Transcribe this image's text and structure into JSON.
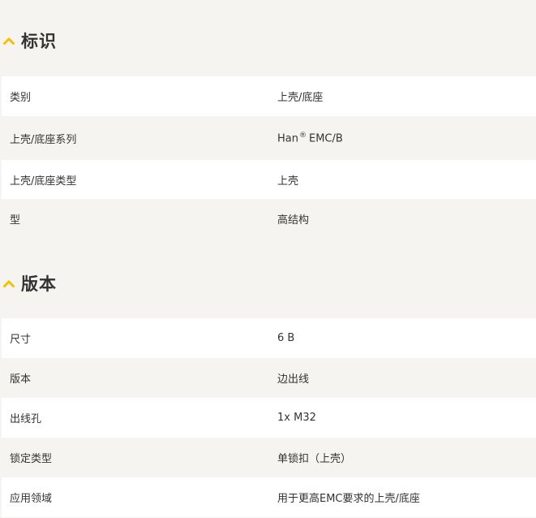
{
  "sections": [
    {
      "title": "标识",
      "rows": [
        {
          "label": "类别",
          "value": "上壳/底座"
        },
        {
          "label": "上壳/底座系列",
          "value_main": "Han",
          "value_mark": "®",
          "value_rest": "EMC/B"
        },
        {
          "label": "上壳/底座类型",
          "value": "上壳"
        },
        {
          "label": "型",
          "value": "高结构"
        }
      ]
    },
    {
      "title": "版本",
      "rows": [
        {
          "label": "尺寸",
          "value": "6 B"
        },
        {
          "label": "版本",
          "value": "边出线"
        },
        {
          "label": "出线孔",
          "value": "1x M32"
        },
        {
          "label": "锁定类型",
          "value": "单锁扣（上壳）"
        },
        {
          "label": "应用领域",
          "value": "用于更高EMC要求的上壳/底座"
        }
      ]
    }
  ],
  "colors": {
    "accent": "#f2c200",
    "row_white": "#ffffff",
    "row_gray": "#f5f4f1",
    "text": "#333333"
  },
  "icons": {
    "section_toggle": "chevron-up-icon"
  }
}
